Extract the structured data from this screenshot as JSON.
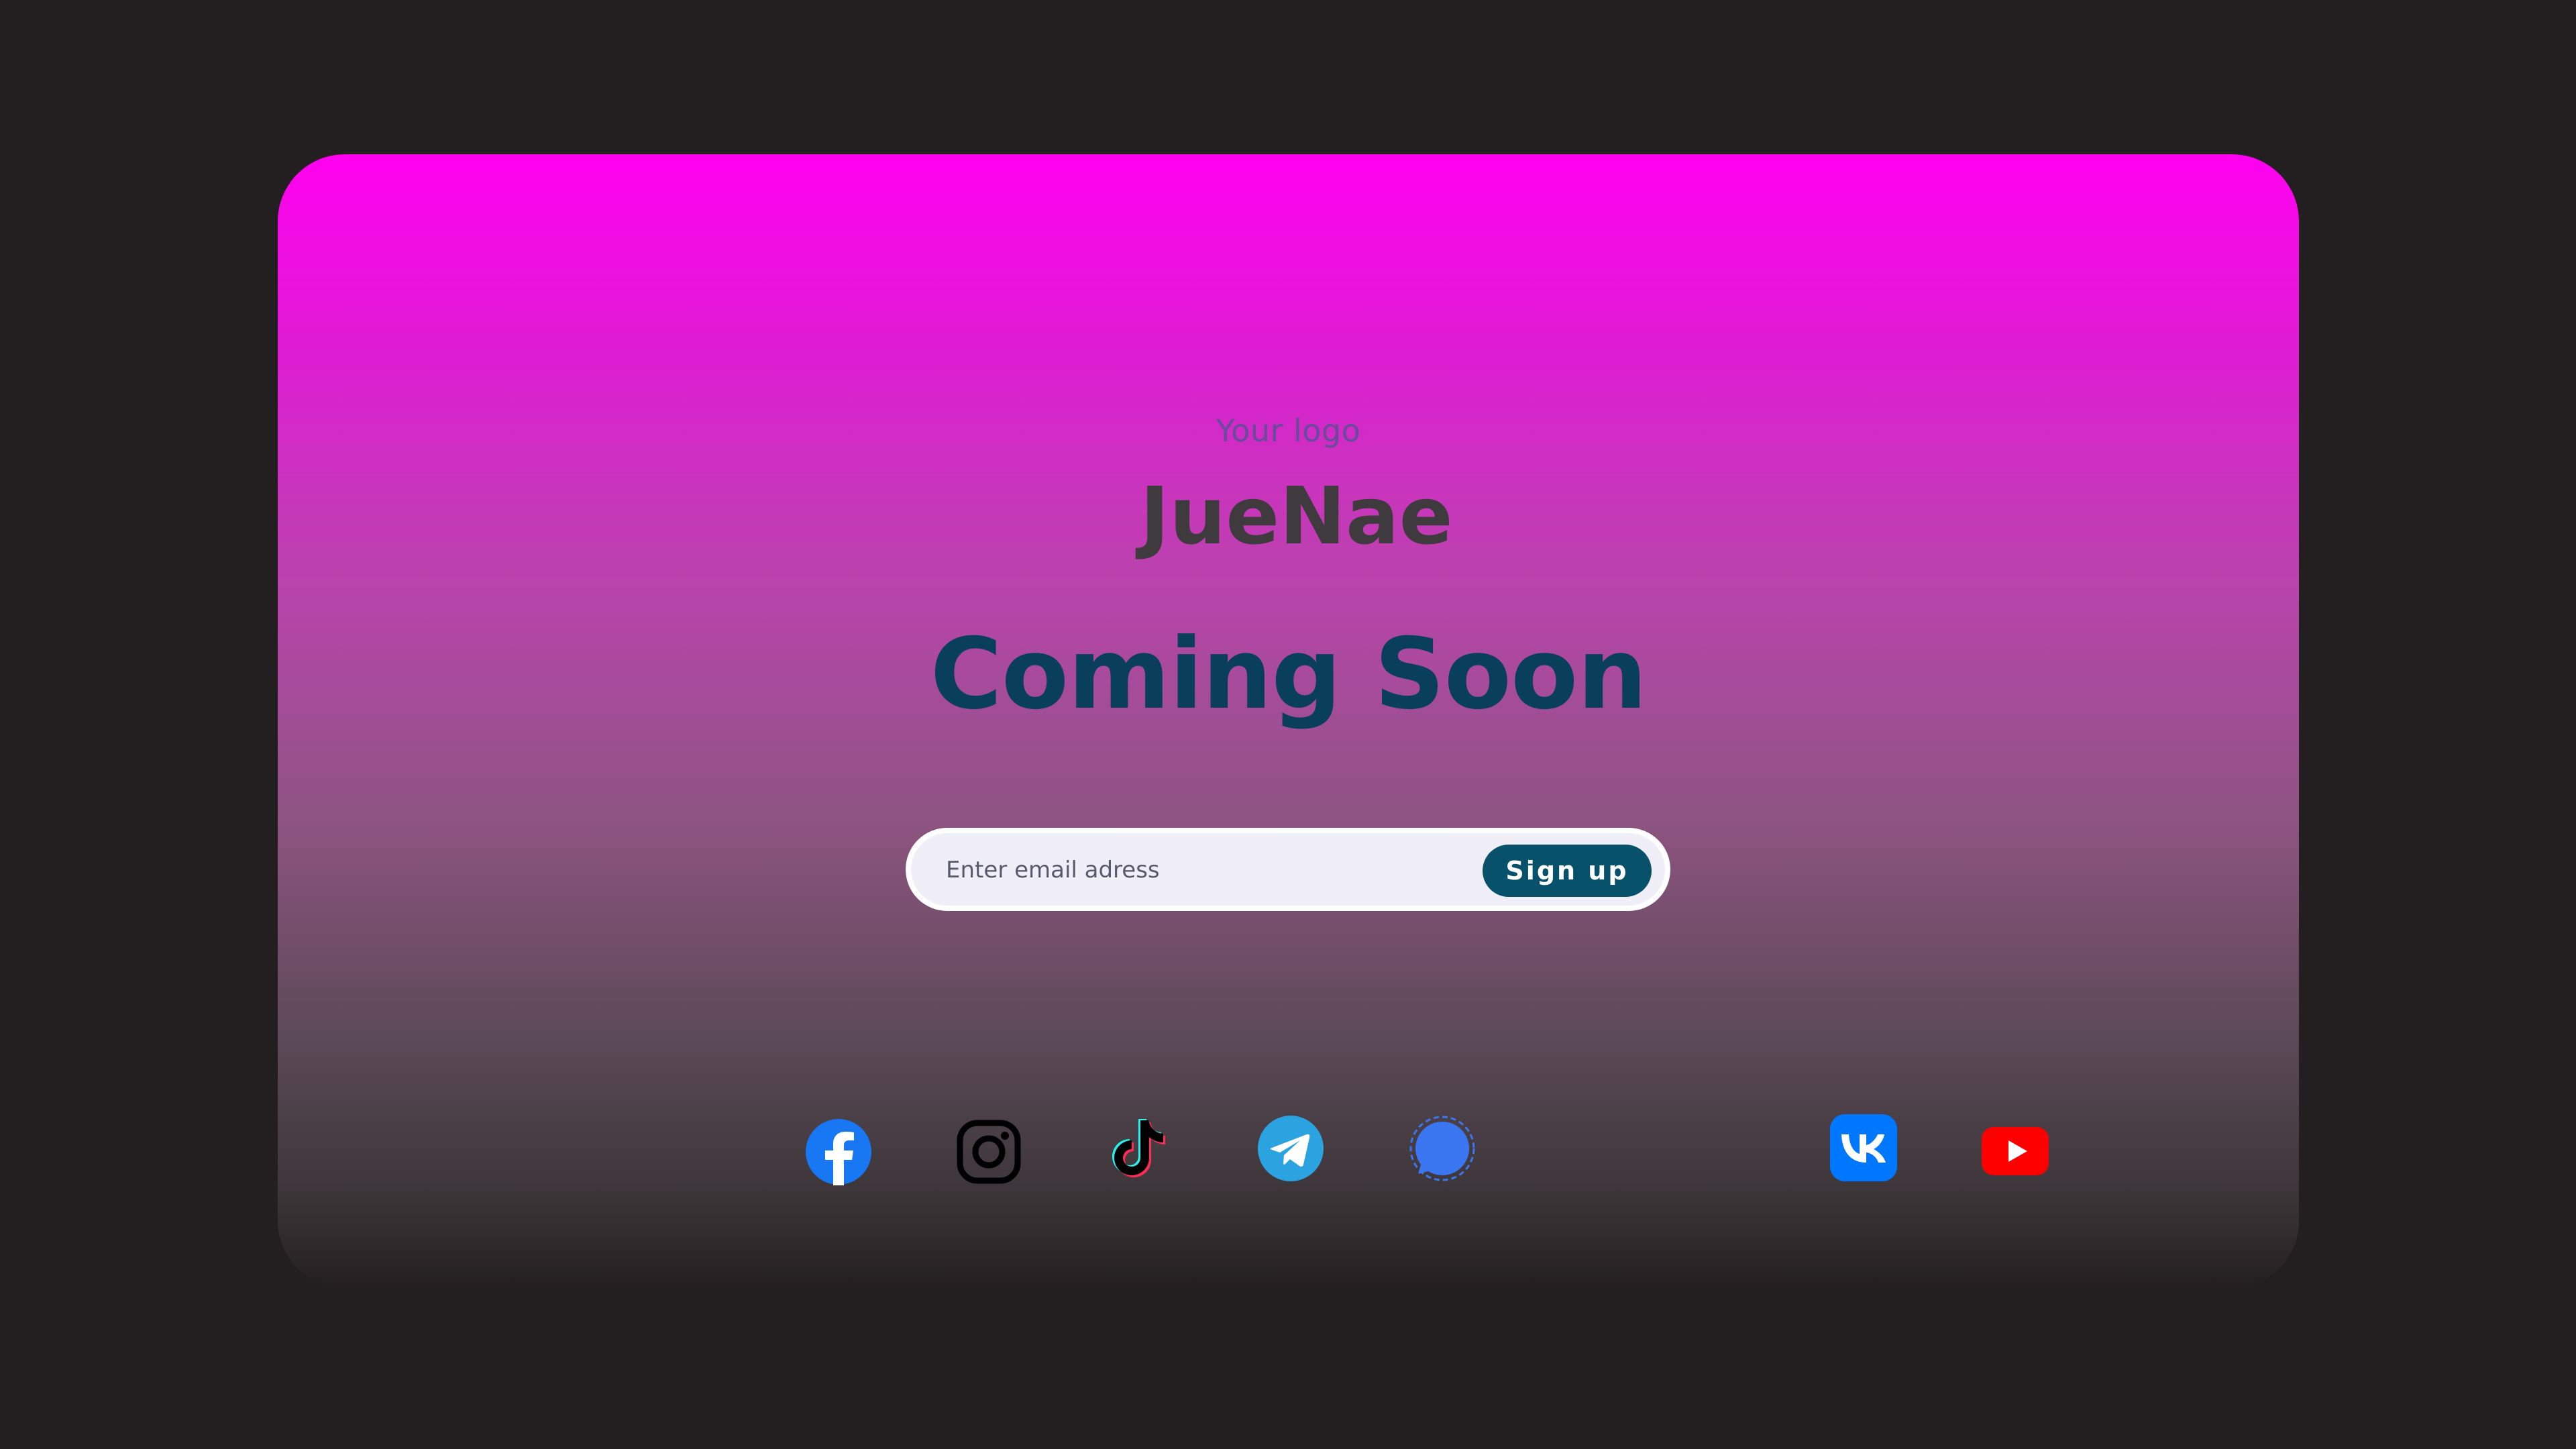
{
  "logo_caption": "Your logo",
  "brand_name": "JueNae",
  "headline": "Coming Soon",
  "signup": {
    "email_placeholder": "Enter email adress",
    "email_value": "",
    "button_label": "Sign up"
  },
  "social": [
    {
      "icon": "facebook-icon",
      "color": "#1877f2"
    },
    {
      "icon": "instagram-icon",
      "color": "#000000"
    },
    {
      "icon": "tiktok-icon",
      "color": "#000000"
    },
    {
      "icon": "telegram-icon",
      "color": "#2aa3e0"
    },
    {
      "icon": "signal-icon",
      "color": "#3a76f0"
    },
    {
      "icon": "vk-icon",
      "color": "#0077ff"
    },
    {
      "icon": "youtube-icon",
      "color": "#ff0000"
    }
  ],
  "colors": {
    "page_background": "#231e1f",
    "gradient_top": "#ff00f0",
    "headline": "#093f5a",
    "brand": "#3f3a3d",
    "button": "#07516b"
  }
}
